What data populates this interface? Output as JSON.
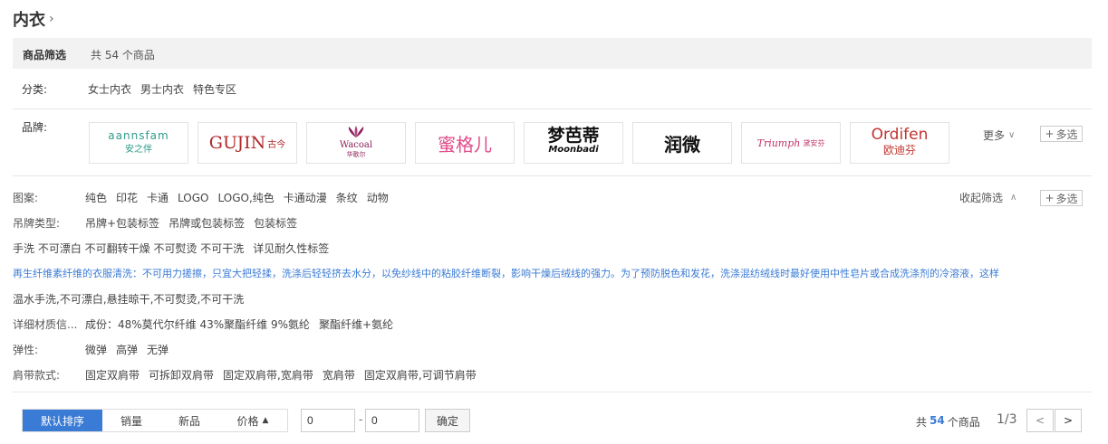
{
  "title": "内衣",
  "summary": {
    "label": "商品筛选",
    "count_text": "共 54 个商品"
  },
  "category": {
    "label": "分类:",
    "items": [
      "女士内衣",
      "男士内衣",
      "特色专区"
    ]
  },
  "brands": {
    "label": "品牌:",
    "items": [
      {
        "line1": "aannsfam",
        "line2": "安之伴",
        "color": "#2e9a8a"
      },
      {
        "line1": "GUJIN",
        "line2": "古今",
        "color": "#b0282b"
      },
      {
        "line1": "Wacoal",
        "line2": "华歌尔",
        "color": "#8a1f5a"
      },
      {
        "line1": "蜜格儿",
        "line2": "",
        "color": "#e04c8a"
      },
      {
        "line1": "梦芭蒂",
        "line2": "Moonbadi",
        "color": "#111111"
      },
      {
        "line1": "润微",
        "line2": "",
        "color": "#111111"
      },
      {
        "line1": "Triumph",
        "line2": "黛安芬",
        "color": "#c0346a"
      },
      {
        "line1": "Ordifen",
        "line2": "欧迪芬",
        "color": "#c0342f"
      }
    ],
    "more_label": "更多",
    "multi_label": "多选"
  },
  "pattern": {
    "label": "图案:",
    "items": [
      "纯色",
      "印花",
      "卡通",
      "LOGO",
      "LOGO,纯色",
      "卡通动漫",
      "条纹",
      "动物"
    ],
    "collapse_label": "收起筛选",
    "multi_label": "多选"
  },
  "tag_type": {
    "label": "吊牌类型:",
    "items": [
      "吊牌+包装标签",
      "吊牌或包装标签",
      "包装标签"
    ]
  },
  "wash_line": {
    "items": [
      "手洗 不可漂白 不可翻转干燥 不可熨烫 不可干洗",
      "详见耐久性标签"
    ]
  },
  "care_line": "再生纤维素纤维的衣服清洗：不可用力搓擦，只宜大把轻揉，洗涤后轻轻挤去水分，以免纱线中的粘胶纤维断裂，影响干燥后绒线的强力。为了预防脱色和发花，洗涤混纺绒线时最好使用中性皂片或合成洗涤剂的冷溶液，这样",
  "warm_line": "温水手洗,不可漂白,悬挂晾干,不可熨烫,不可干洗",
  "material": {
    "label": "详细材质信...",
    "items": [
      "成份：48%莫代尔纤维 43%聚酯纤维 9%氨纶",
      "聚酯纤维+氨纶"
    ]
  },
  "elasticity": {
    "label": "弹性:",
    "items": [
      "微弹",
      "高弹",
      "无弹"
    ]
  },
  "strap": {
    "label": "肩带款式:",
    "items": [
      "固定双肩带",
      "可拆卸双肩带",
      "固定双肩带,宽肩带",
      "宽肩带",
      "固定双肩带,可调节肩带"
    ]
  },
  "sort": {
    "items": [
      "默认排序",
      "销量",
      "新品",
      "价格"
    ],
    "active": "默认排序",
    "price_arrow": "▲"
  },
  "price_filter": {
    "min": "0",
    "max": "0",
    "dash": "-",
    "confirm_label": "确定"
  },
  "footer": {
    "total_prefix": "共",
    "total_count": "54",
    "total_suffix": "个商品",
    "page_text": "1/3",
    "prev": "<",
    "next": ">"
  },
  "colors": {
    "accent": "#3a7bd5"
  }
}
